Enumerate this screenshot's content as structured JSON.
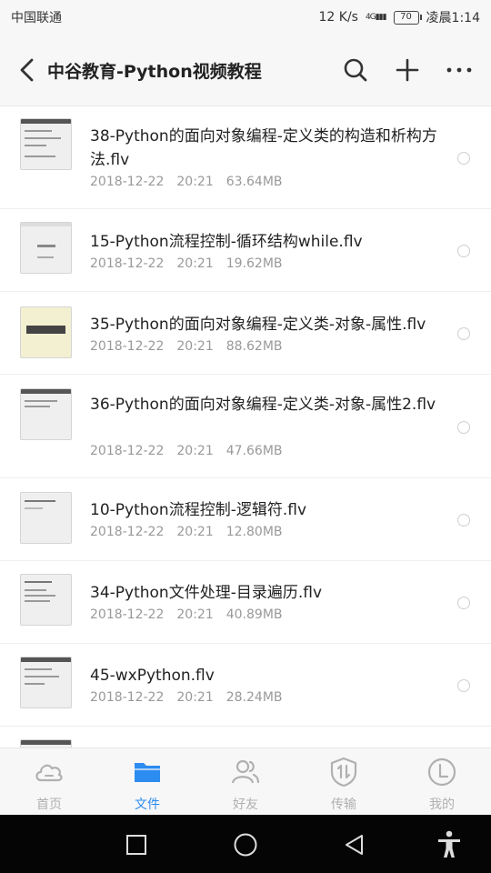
{
  "status_bar": {
    "carrier": "中国联通",
    "speed": "12 K/s",
    "network": "4G",
    "battery": "70",
    "time": "凌晨1:14"
  },
  "header": {
    "title": "中谷教育-Python视频教程",
    "icons": [
      "back-icon",
      "search-icon",
      "add-icon",
      "more-icon"
    ]
  },
  "files": [
    {
      "name": "38-Python的面向对象编程-定义类的构造和析构方法.flv",
      "date": "2018-12-22",
      "time": "20:21",
      "size": "63.64MB"
    },
    {
      "name": "15-Python流程控制-循环结构while.flv",
      "date": "2018-12-22",
      "time": "20:21",
      "size": "19.62MB"
    },
    {
      "name": "35-Python的面向对象编程-定义类-对象-属性.flv",
      "date": "2018-12-22",
      "time": "20:21",
      "size": "88.62MB"
    },
    {
      "name": "36-Python的面向对象编程-定义类-对象-属性2.flv",
      "date": "2018-12-22",
      "time": "20:21",
      "size": "47.66MB"
    },
    {
      "name": "10-Python流程控制-逻辑符.flv",
      "date": "2018-12-22",
      "time": "20:21",
      "size": "12.80MB"
    },
    {
      "name": "34-Python文件处理-目录遍历.flv",
      "date": "2018-12-22",
      "time": "20:21",
      "size": "40.89MB"
    },
    {
      "name": "45-wxPython.flv",
      "date": "2018-12-22",
      "time": "20:21",
      "size": "28.24MB"
    }
  ],
  "bottom_nav": [
    {
      "label": "首页",
      "icon": "cloud-icon"
    },
    {
      "label": "文件",
      "icon": "folder-icon"
    },
    {
      "label": "好友",
      "icon": "friends-icon"
    },
    {
      "label": "传输",
      "icon": "transfer-icon"
    },
    {
      "label": "我的",
      "icon": "profile-icon"
    }
  ],
  "colors": {
    "accent": "#2d8cf0",
    "inactive": "#b0b0b0",
    "meta_text": "#999999"
  },
  "system_nav": [
    "square-icon",
    "home-circle-icon",
    "back-triangle-icon",
    "accessibility-icon"
  ]
}
